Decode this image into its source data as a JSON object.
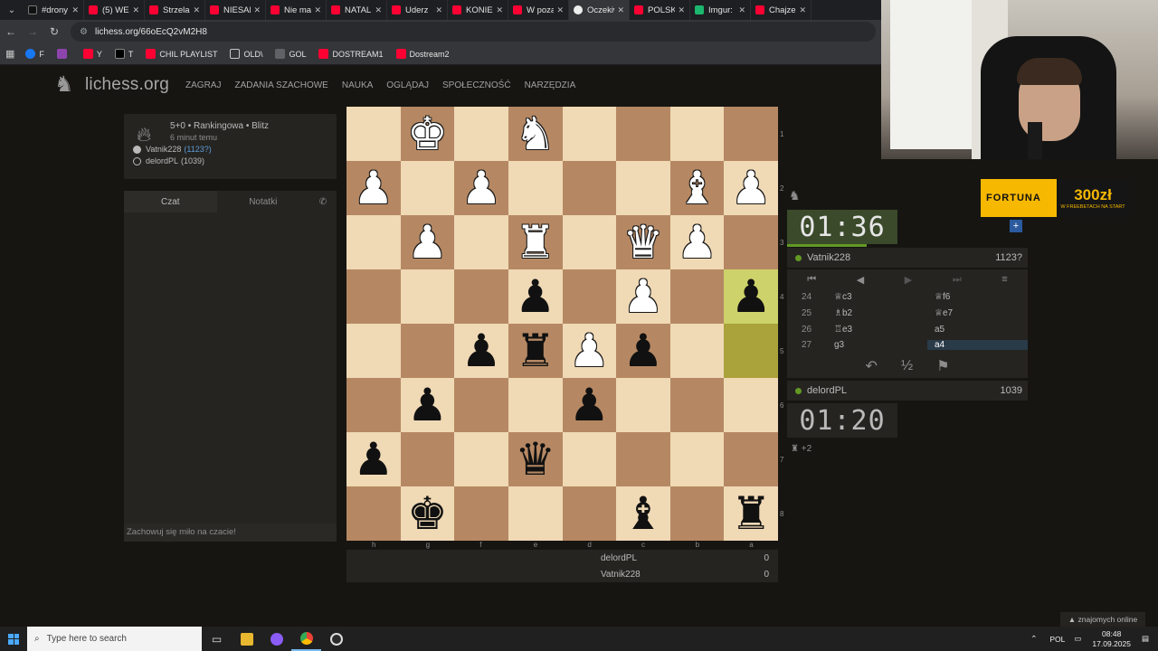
{
  "tabs": [
    {
      "title": "#drony",
      "type": "tt"
    },
    {
      "title": "(5) WE",
      "type": "yt"
    },
    {
      "title": "Strzela",
      "type": "yt"
    },
    {
      "title": "NIESAM",
      "type": "yt"
    },
    {
      "title": "Nie ma",
      "type": "yt"
    },
    {
      "title": "NATALI",
      "type": "yt"
    },
    {
      "title": "Uderz",
      "type": "yt"
    },
    {
      "title": "KONIEC",
      "type": "yt"
    },
    {
      "title": "W poza",
      "type": "yt"
    },
    {
      "title": "Oczekiw",
      "type": "li",
      "active": true
    },
    {
      "title": "POLSK",
      "type": "yt"
    },
    {
      "title": "Imgur:",
      "type": "im"
    },
    {
      "title": "Chajze",
      "type": "yt"
    }
  ],
  "url": "lichess.org/66oEcQ2vM2H8",
  "bookmarks": [
    {
      "label": "F",
      "icon": "fb"
    },
    {
      "label": "",
      "icon": "ms"
    },
    {
      "label": "Y",
      "icon": "yt"
    },
    {
      "label": "T",
      "icon": "xx"
    },
    {
      "label": "CHIL PLAYLIST",
      "icon": "yt"
    },
    {
      "label": "OLD\\",
      "icon": "fo"
    },
    {
      "label": "GOL",
      "icon": "gr"
    },
    {
      "label": "DOSTREAM1",
      "icon": "yt"
    },
    {
      "label": "Dostream2",
      "icon": "yt"
    }
  ],
  "site": {
    "brand": "lichess.org",
    "menu": [
      "ZAGRAJ",
      "ZADANIA SZACHOWE",
      "NAUKA",
      "OGLĄDAJ",
      "SPOŁECZNOŚĆ",
      "NARZĘDZIA"
    ]
  },
  "game": {
    "setup": "5+0 • Rankingowa • Blitz",
    "ago": "6 minut temu",
    "white": {
      "name": "Vatnik228",
      "rating": "(1123?)"
    },
    "black": {
      "name": "delordPL",
      "rating": "(1039)"
    }
  },
  "chat": {
    "tab_chat": "Czat",
    "tab_notes": "Notatki",
    "placeholder": "Zachowuj się miło na czacie!"
  },
  "board": {
    "files": [
      "h",
      "g",
      "f",
      "e",
      "d",
      "c",
      "b",
      "a"
    ],
    "ranks": [
      "1",
      "2",
      "3",
      "4",
      "5",
      "6",
      "7",
      "8"
    ],
    "pieces": [
      [
        null,
        {
          "g": "♚",
          "c": "w"
        },
        null,
        {
          "g": "♞",
          "c": "w"
        },
        null,
        null,
        null,
        null
      ],
      [
        {
          "g": "♟",
          "c": "w"
        },
        null,
        {
          "g": "♟",
          "c": "w"
        },
        null,
        null,
        null,
        {
          "g": "♝",
          "c": "w"
        },
        {
          "g": "♟",
          "c": "w"
        }
      ],
      [
        null,
        {
          "g": "♟",
          "c": "w"
        },
        null,
        {
          "g": "♜",
          "c": "w"
        },
        null,
        {
          "g": "♛",
          "c": "w"
        },
        {
          "g": "♟",
          "c": "w"
        },
        null
      ],
      [
        null,
        null,
        null,
        {
          "g": "♟",
          "c": "b"
        },
        null,
        {
          "g": "♟",
          "c": "w"
        },
        null,
        {
          "g": "♟",
          "c": "b"
        }
      ],
      [
        null,
        null,
        {
          "g": "♟",
          "c": "b"
        },
        {
          "g": "♜",
          "c": "b"
        },
        {
          "g": "♟",
          "c": "w"
        },
        {
          "g": "♟",
          "c": "b"
        },
        null,
        null
      ],
      [
        null,
        {
          "g": "♟",
          "c": "b"
        },
        null,
        null,
        {
          "g": "♟",
          "c": "b"
        },
        null,
        null,
        null
      ],
      [
        {
          "g": "♟",
          "c": "b"
        },
        null,
        null,
        {
          "g": "♛",
          "c": "b"
        },
        null,
        null,
        null,
        null
      ],
      [
        null,
        {
          "g": "♚",
          "c": "b"
        },
        null,
        null,
        null,
        {
          "g": "♝",
          "c": "b"
        },
        null,
        {
          "g": "♜",
          "c": "b"
        }
      ]
    ],
    "highlights": [
      [
        3,
        7
      ],
      [
        4,
        7
      ]
    ]
  },
  "score": [
    {
      "name": "delordPL",
      "score": "0"
    },
    {
      "name": "Vatnik228",
      "score": "0"
    }
  ],
  "clocks": {
    "top": {
      "time": "01:36",
      "player": "Vatnik228",
      "rating": "1123?"
    },
    "bottom": {
      "time": "01:20",
      "player": "delordPL",
      "rating": "1039"
    }
  },
  "moves": [
    {
      "num": "24",
      "w": "♕c3",
      "b": "♕f6"
    },
    {
      "num": "25",
      "w": "♗b2",
      "b": "♕e7"
    },
    {
      "num": "26",
      "w": "♖e3",
      "b": "a5"
    },
    {
      "num": "27",
      "w": "g3",
      "b": "a4"
    }
  ],
  "actions": {
    "draw": "½"
  },
  "captured": "+2",
  "ad": {
    "brand": "FORTUNA",
    "amount": "300zł",
    "sub": "W FREEBETACH NA START"
  },
  "friends": "▲ znajomych online",
  "taskbar": {
    "search": "Type here to search",
    "lang": "POL",
    "time": "08:48",
    "date": "17.09.2025"
  }
}
